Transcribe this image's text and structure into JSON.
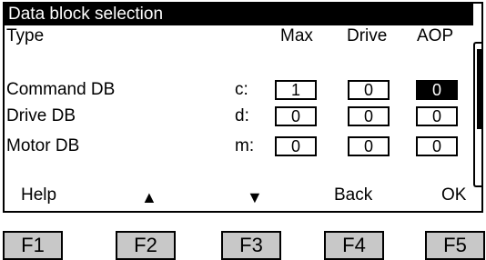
{
  "screen": {
    "title": "Data block selection",
    "headers": {
      "type": "Type",
      "max": "Max",
      "drive": "Drive",
      "aop": "AOP"
    },
    "rows": [
      {
        "label": "Command DB",
        "code": "c:",
        "max": "1",
        "drive": "0",
        "aop": "0"
      },
      {
        "label": "Drive DB",
        "code": "d:",
        "max": "0",
        "drive": "0",
        "aop": "0"
      },
      {
        "label": "Motor DB",
        "code": "m:",
        "max": "0",
        "drive": "0",
        "aop": "0"
      }
    ],
    "softkeys": {
      "f1": "Help",
      "f2": "▲",
      "f3": "▼",
      "f4": "Back",
      "f5": "OK"
    }
  },
  "fkeys": [
    "F1",
    "F2",
    "F3",
    "F4",
    "F5"
  ],
  "colors": {
    "selected_field_bg": "#000000",
    "fkey_bg": "#c8c8c8"
  }
}
